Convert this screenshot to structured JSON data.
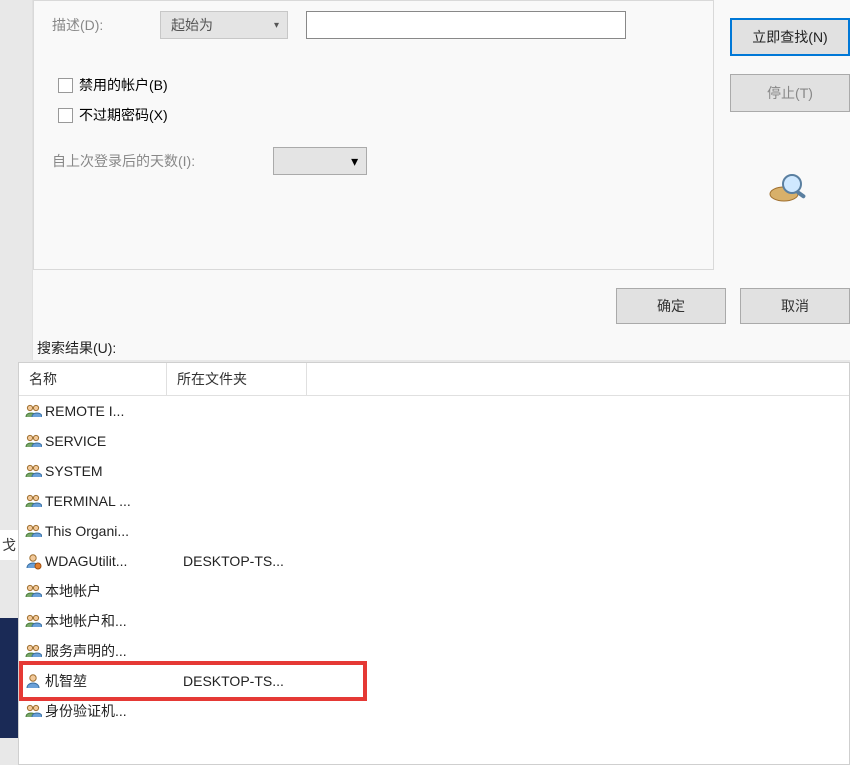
{
  "form": {
    "description_label": "描述(D):",
    "description_mode": "起始为",
    "disabled_accounts_label": "禁用的帐户(B)",
    "no_expire_pwd_label": "不过期密码(X)",
    "days_since_login_label": "自上次登录后的天数(I):"
  },
  "buttons": {
    "find_now": "立即查找(N)",
    "stop": "停止(T)",
    "ok": "确定",
    "cancel": "取消"
  },
  "results": {
    "label": "搜索结果(U):",
    "columns": {
      "name": "名称",
      "folder": "所在文件夹"
    },
    "rows": [
      {
        "icon": "group",
        "name": "REMOTE I...",
        "folder": ""
      },
      {
        "icon": "group",
        "name": "SERVICE",
        "folder": ""
      },
      {
        "icon": "group",
        "name": "SYSTEM",
        "folder": ""
      },
      {
        "icon": "group",
        "name": "TERMINAL ...",
        "folder": ""
      },
      {
        "icon": "group",
        "name": "This Organi...",
        "folder": ""
      },
      {
        "icon": "user-badge",
        "name": "WDAGUtilit...",
        "folder": "DESKTOP-TS..."
      },
      {
        "icon": "group",
        "name": "本地帐户",
        "folder": ""
      },
      {
        "icon": "group",
        "name": "本地帐户和...",
        "folder": ""
      },
      {
        "icon": "group",
        "name": "服务声明的...",
        "folder": ""
      },
      {
        "icon": "user",
        "name": "机智堃",
        "folder": "DESKTOP-TS...",
        "highlighted": true
      },
      {
        "icon": "group",
        "name": "身份验证机...",
        "folder": ""
      }
    ]
  },
  "left_hint": "戈"
}
